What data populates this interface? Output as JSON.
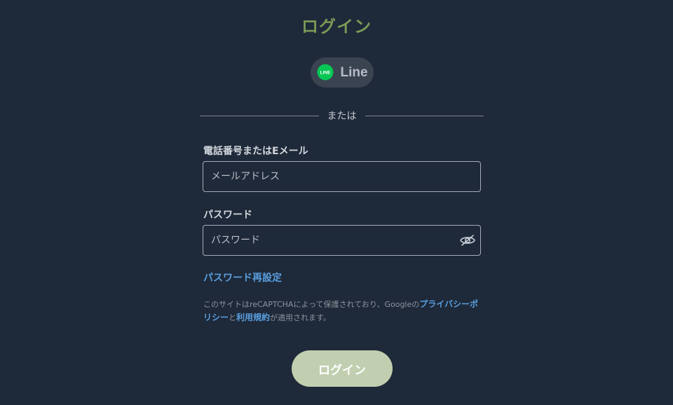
{
  "page": {
    "title": "ログイン"
  },
  "social": {
    "line_badge_text": "LINE",
    "line_label": "Line",
    "icon": "line-chat-bubble-icon",
    "brand_color": "#06c755"
  },
  "divider": {
    "text": "または"
  },
  "form": {
    "email_label": "電話番号またはEメール",
    "email_placeholder": "メールアドレス",
    "email_value": "",
    "password_label": "パスワード",
    "password_placeholder": "パスワード",
    "password_value": "",
    "password_toggle_icon": "eye-slash-icon"
  },
  "links": {
    "reset_password": "パスワード再設定"
  },
  "recaptcha": {
    "prefix": "このサイトはreCAPTCHAによって保護されており、Googleの",
    "privacy_link": "プライバシーポリシー",
    "and_text": "と",
    "terms_link": "利用規約",
    "suffix": "が適用されます。"
  },
  "actions": {
    "login_button": "ログイン"
  },
  "colors": {
    "background": "#1e2939",
    "title": "#7a9a57",
    "link": "#5a9fe0",
    "login_button_bg": "#c1cfb0"
  }
}
